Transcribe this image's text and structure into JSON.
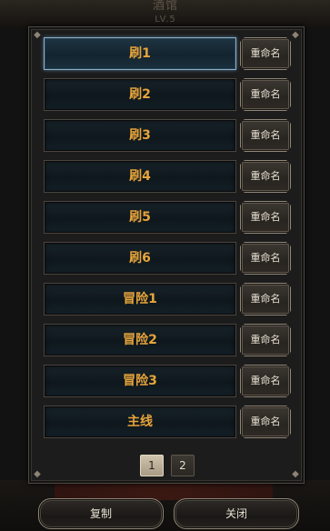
{
  "background": {
    "title": "酒馆",
    "level": "LV.5"
  },
  "slots": [
    {
      "label": "刷1",
      "active": true
    },
    {
      "label": "刷2"
    },
    {
      "label": "刷3"
    },
    {
      "label": "刷4"
    },
    {
      "label": "刷5"
    },
    {
      "label": "刷6"
    },
    {
      "label": "冒险1"
    },
    {
      "label": "冒险2"
    },
    {
      "label": "冒险3"
    },
    {
      "label": "主线"
    }
  ],
  "rename_label": "重命名",
  "pagination": {
    "pages": [
      "1",
      "2"
    ],
    "current": "1"
  },
  "buttons": {
    "copy": "复制",
    "close": "关闭"
  },
  "colors": {
    "slot_text": "#e7a43b",
    "active_border": "#8ab0c8",
    "panel_bg": "#1c1c1c"
  }
}
